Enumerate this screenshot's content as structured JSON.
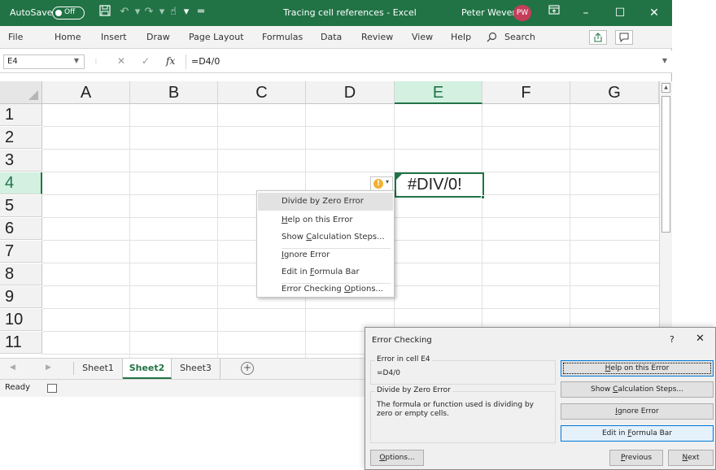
{
  "titlebar": {
    "autosave_label": "AutoSave",
    "autosave_state": "Off",
    "doc_title": "Tracing cell references - Excel",
    "user_name": "Peter Weverka",
    "user_initials": "PW",
    "accent": "#217346"
  },
  "menu": {
    "items": [
      "File",
      "Home",
      "Insert",
      "Draw",
      "Page Layout",
      "Formulas",
      "Data",
      "Review",
      "View",
      "Help"
    ],
    "search_label": "Search"
  },
  "formula_bar": {
    "name_box": "E4",
    "fx": "fx",
    "formula": "=D4/0"
  },
  "grid": {
    "columns": [
      "A",
      "B",
      "C",
      "D",
      "E",
      "F",
      "G"
    ],
    "rows": [
      "1",
      "2",
      "3",
      "4",
      "5",
      "6",
      "7",
      "8",
      "9",
      "10",
      "11"
    ],
    "selected_column": "E",
    "selected_row": "4",
    "active_cell_value": "#DIV/0!",
    "smart_tag_icon": "!"
  },
  "context_menu": {
    "items": [
      {
        "pre": "",
        "key": "",
        "post": "Divide by Zero Error"
      },
      {
        "pre": "",
        "key": "H",
        "post": "elp on this Error"
      },
      {
        "pre": "Show ",
        "key": "C",
        "post": "alculation Steps..."
      },
      {
        "pre": "",
        "key": "I",
        "post": "gnore Error"
      },
      {
        "pre": "Edit in ",
        "key": "F",
        "post": "ormula Bar"
      },
      {
        "pre": "Error Checking ",
        "key": "O",
        "post": "ptions..."
      }
    ]
  },
  "sheets": {
    "tabs": [
      "Sheet1",
      "Sheet2",
      "Sheet3"
    ],
    "active": "Sheet2",
    "add_label": "+"
  },
  "status": {
    "ready": "Ready"
  },
  "dialog": {
    "title": "Error Checking",
    "help": "?",
    "close": "✕",
    "error_in_label": "Error in cell E4",
    "formula": "=D4/0",
    "error_type": "Divide by Zero Error",
    "description": "The formula or function used is dividing by zero or empty cells.",
    "buttons": {
      "help": {
        "pre": "",
        "key": "H",
        "post": "elp on this Error"
      },
      "calc": {
        "pre": "Show ",
        "key": "C",
        "post": "alculation Steps..."
      },
      "ignore": {
        "pre": "",
        "key": "I",
        "post": "gnore Error"
      },
      "edit": {
        "pre": "Edit in ",
        "key": "F",
        "post": "ormula Bar"
      },
      "options": {
        "pre": "",
        "key": "O",
        "post": "ptions..."
      },
      "previous": {
        "pre": "",
        "key": "P",
        "post": "revious"
      },
      "next": {
        "pre": "",
        "key": "N",
        "post": "ext"
      }
    }
  }
}
